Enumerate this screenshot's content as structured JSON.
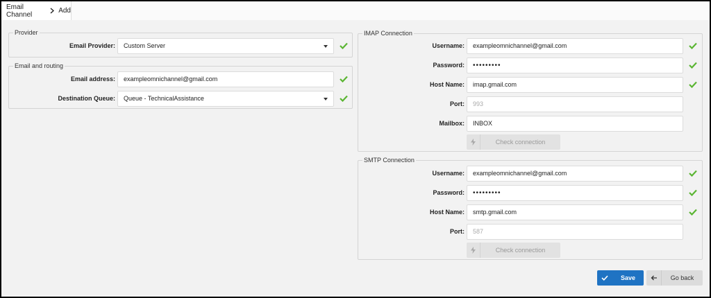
{
  "breadcrumb": {
    "root": "Email Channel",
    "current": "Add"
  },
  "provider": {
    "title": "Provider",
    "email_provider_label": "Email Provider:",
    "email_provider_value": "Custom Server"
  },
  "routing": {
    "title": "Email and routing",
    "email_label": "Email address:",
    "email_value": "exampleomnichannel@gmail.com",
    "queue_label": "Destination Queue:",
    "queue_value": "Queue - TechnicalAssistance"
  },
  "imap": {
    "title": "IMAP Connection",
    "username_label": "Username:",
    "username_value": "exampleomnichannel@gmail.com",
    "password_label": "Password:",
    "password_value": "•••••••••",
    "host_label": "Host Name:",
    "host_value": "imap.gmail.com",
    "port_label": "Port:",
    "port_placeholder": "993",
    "mailbox_label": "Mailbox:",
    "mailbox_value": "INBOX",
    "check_label": "Check connection"
  },
  "smtp": {
    "title": "SMTP Connection",
    "username_label": "Username:",
    "username_value": "exampleomnichannel@gmail.com",
    "password_label": "Password:",
    "password_value": "•••••••••",
    "host_label": "Host Name:",
    "host_value": "smtp.gmail.com",
    "port_label": "Port:",
    "port_placeholder": "587",
    "check_label": "Check connection"
  },
  "actions": {
    "save_label": "Save",
    "back_label": "Go back"
  },
  "icons": {
    "valid": "check-icon",
    "test": "lightning-icon",
    "save": "check-icon",
    "back": "arrow-left-icon",
    "breadcrumb_sep": "chevron-right-icon"
  },
  "colors": {
    "valid": "#5ab532",
    "primary": "#1f73c3",
    "disabled": "#e2e2e2"
  }
}
